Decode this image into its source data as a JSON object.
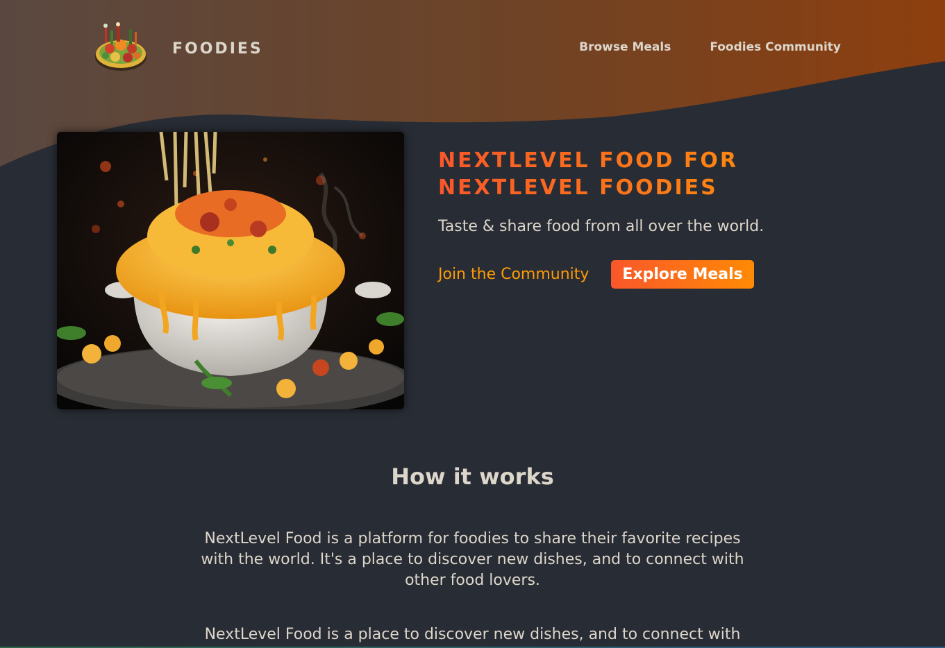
{
  "header": {
    "logo_text": "FOODIES",
    "nav": [
      {
        "label": "Browse Meals"
      },
      {
        "label": "Foodies Community"
      }
    ]
  },
  "hero": {
    "title_line1": "NEXTLEVEL FOOD FOR",
    "title_line2": "NEXTLEVEL FOODIES",
    "subtitle": "Taste & share food from all over the world.",
    "join_label": "Join the Community",
    "explore_label": "Explore Meals"
  },
  "how": {
    "title": "How it works",
    "paragraph1": "NextLevel Food is a platform for foodies to share their favorite recipes with the world. It's a place to discover new dishes, and to connect with other food lovers.",
    "paragraph2": "NextLevel Food is a place to discover new dishes, and to connect with"
  },
  "colors": {
    "accent_start": "#f9572a",
    "accent_end": "#ff9b05",
    "background": "#282c34",
    "text": "#ddd6cb"
  }
}
